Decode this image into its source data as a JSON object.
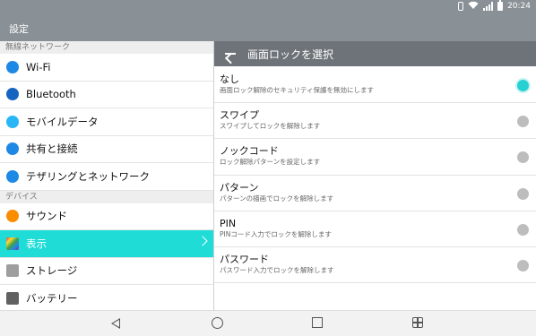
{
  "status": {
    "time": "20:24"
  },
  "app": {
    "title": "設定"
  },
  "sidebar": {
    "sections": [
      {
        "title": "無線ネットワーク",
        "items": [
          {
            "label": "Wi-Fi",
            "icon": "wifi-icon",
            "color": "#1e88e5"
          },
          {
            "label": "Bluetooth",
            "icon": "bluetooth-icon",
            "color": "#1565c0"
          },
          {
            "label": "モバイルデータ",
            "icon": "mobile-data-icon",
            "color": "#29b6f6"
          },
          {
            "label": "共有と接続",
            "icon": "share-icon",
            "color": "#1e88e5"
          },
          {
            "label": "テザリングとネットワーク",
            "icon": "tethering-icon",
            "color": "#1e88e5"
          }
        ]
      },
      {
        "title": "デバイス",
        "items": [
          {
            "label": "サウンド",
            "icon": "sound-icon",
            "color": "#fb8c00"
          },
          {
            "label": "表示",
            "icon": "display-icon",
            "color": "#7b1fa2",
            "active": true
          },
          {
            "label": "ストレージ",
            "icon": "storage-icon",
            "color": "#9e9e9e"
          },
          {
            "label": "バッテリー",
            "icon": "battery-icon",
            "color": "#616161"
          }
        ]
      }
    ],
    "active_color": "#1fdcd7"
  },
  "detail": {
    "title": "画面ロックを選択",
    "options": [
      {
        "title": "なし",
        "subtitle": "画面ロック解除のセキュリティ保護を無効にします",
        "selected": true
      },
      {
        "title": "スワイプ",
        "subtitle": "スワイプしてロックを解除します",
        "selected": false
      },
      {
        "title": "ノックコード",
        "subtitle": "ロック解除パターンを設定します",
        "selected": false
      },
      {
        "title": "パターン",
        "subtitle": "パターンの描画でロックを解除します",
        "selected": false
      },
      {
        "title": "PIN",
        "subtitle": "PINコード入力でロックを解除します",
        "selected": false
      },
      {
        "title": "パスワード",
        "subtitle": "パスワード入力でロックを解除します",
        "selected": false
      }
    ]
  }
}
